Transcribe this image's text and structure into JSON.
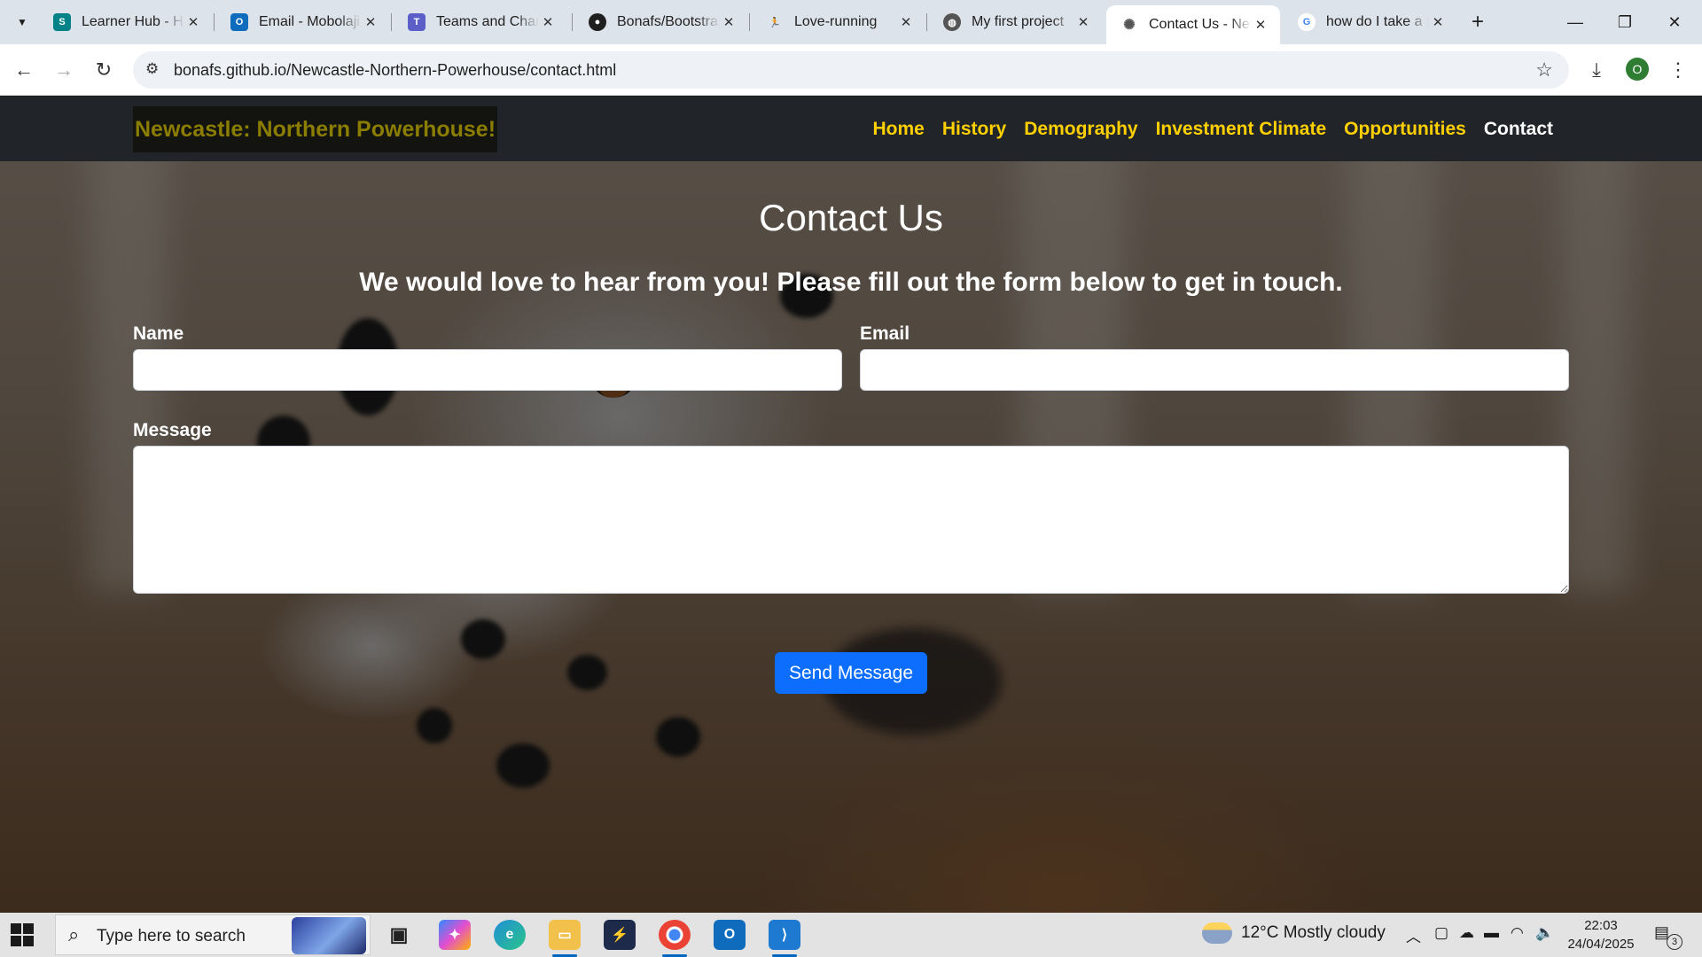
{
  "browser": {
    "tabs": [
      {
        "title": "Learner Hub - Home",
        "icon": "sharepoint-icon",
        "color": "#038387"
      },
      {
        "title": "Email - Mobolaji",
        "icon": "outlook-icon",
        "color": "#0f6cbd"
      },
      {
        "title": "Teams and Channels",
        "icon": "teams-icon",
        "color": "#5b5fc7"
      },
      {
        "title": "Bonafs/Bootstrap",
        "icon": "github-icon",
        "color": "#1f1f1f"
      },
      {
        "title": "Love-running",
        "icon": "runner-icon",
        "color": "#f0b400"
      },
      {
        "title": "My first project",
        "icon": "globe-icon",
        "color": "#444444"
      },
      {
        "title": "Contact Us - Newcastle",
        "icon": "page-icon",
        "color": "#555555"
      },
      {
        "title": "how do I take a screenshot",
        "icon": "google-icon",
        "color": "#4285f4"
      }
    ],
    "new_tab": "+",
    "url": "bonafs.github.io/Newcastle-Northern-Powerhouse/contact.html",
    "profile_initial": "O"
  },
  "site": {
    "brand": "Newcastle: Northern Powerhouse!",
    "nav": [
      "Home",
      "History",
      "Demography",
      "Investment Climate",
      "Opportunities",
      "Contact"
    ],
    "active_nav": "Contact"
  },
  "contact": {
    "title": "Contact Us",
    "lead": "We would love to hear from you! Please fill out the form below to get in touch.",
    "name_label": "Name",
    "email_label": "Email",
    "message_label": "Message",
    "name_value": "",
    "email_value": "",
    "message_value": "",
    "submit_label": "Send Message"
  },
  "taskbar": {
    "search_placeholder": "Type here to search",
    "weather": "12°C  Mostly cloudy",
    "time": "22:03",
    "date": "24/04/2025",
    "notification_count": "3"
  },
  "colors": {
    "accent_nav": "#ffd000",
    "brand_text": "#8b7d00",
    "button": "#0d6efd",
    "navbar": "#212529"
  }
}
